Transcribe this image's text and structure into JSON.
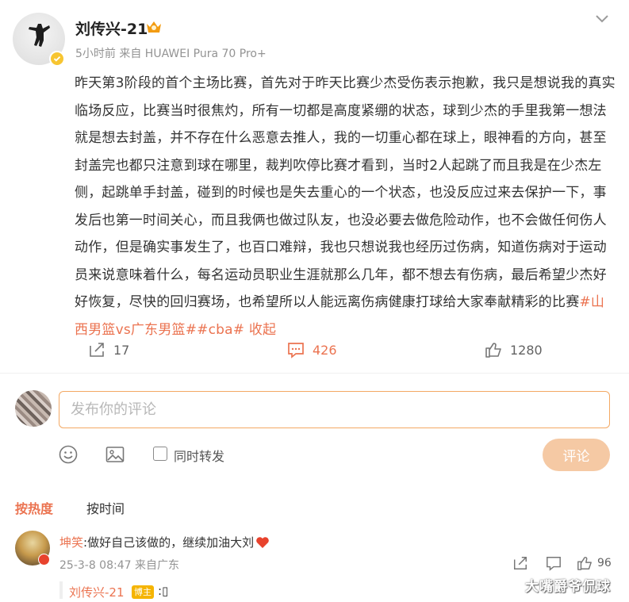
{
  "author": {
    "name": "刘传兴-21",
    "meta": "5小时前  来自 HUAWEI Pura 70 Pro+"
  },
  "post": {
    "text": "昨天第3阶段的首个主场比赛，首先对于昨天比赛少杰受伤表示抱歉，我只是想说我的真实临场反应，比赛当时很焦灼，所有一切都是高度紧绷的状态，球到少杰的手里我第一想法就是想去封盖，并不存在什么恶意去推人，我的一切重心都在球上，眼神看的方向，甚至封盖完也都只注意到球在哪里，裁判吹停比赛才看到，当时2人起跳了而且我是在少杰左侧，起跳单手封盖，碰到的时候也是失去重心的一个状态，也没反应过来去保护一下，事发后也第一时间关心，而且我俩也做过队友，也没必要去做危险动作，也不会做任何伤人动作，但是确实事发生了，也百口难辩，我也只想说我也经历过伤病，知道伤病对于运动员来说意味着什么，每名运动员职业生涯就那么几年，都不想去有伤病，最后希望少杰好好恢复，尽快的回归赛场，也希望所以人能远离伤病健康打球给大家奉献精彩的比赛",
    "tag1": "#山西男篮vs广东男篮#",
    "tag2": "#cba#",
    "collapse": " 收起"
  },
  "actions": {
    "repost_count": "17",
    "comment_count": "426",
    "like_count": "1280"
  },
  "composer": {
    "placeholder": "发布你的评论",
    "repost_label": "同时转发",
    "submit_label": "评论"
  },
  "sort": {
    "hot": "按热度",
    "time": "按时间"
  },
  "comment": {
    "user": "坤笑",
    "text": ":做好自己该做的，继续加油大刘",
    "meta": "25-3-8 08:47 来自广东",
    "like_count": "96"
  },
  "reply": {
    "user": "刘传兴-21",
    "badge": "博主",
    "text": ":▯"
  },
  "watermark": "大嘴爵爷侃球",
  "colors": {
    "accent": "#eb7350",
    "verified": "#f7c531",
    "submit_disabled": "#f5c9a4"
  }
}
